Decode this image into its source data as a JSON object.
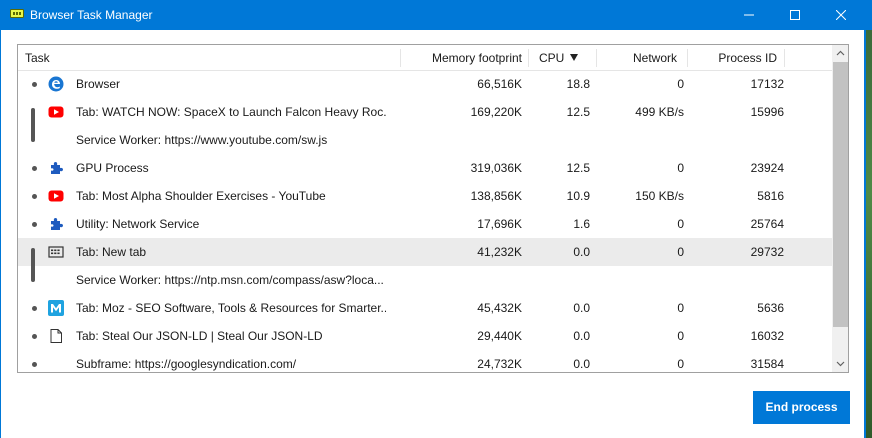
{
  "window": {
    "title": "Browser Task Manager",
    "icons": {
      "app": "browser-task-manager-icon",
      "minimize": "minimize-icon",
      "maximize": "maximize-icon",
      "close": "close-icon"
    }
  },
  "table": {
    "columns": {
      "task": "Task",
      "memory": "Memory footprint",
      "cpu": "CPU",
      "network": "Network",
      "pid": "Process ID"
    },
    "sorted_column": "CPU",
    "sort_direction": "descending",
    "rows": [
      {
        "icon": "edge-icon",
        "task": "Browser",
        "memory": "66,516K",
        "cpu": "18.8",
        "network": "0",
        "pid": "17132"
      },
      {
        "icon": "youtube-icon",
        "task": "Tab: WATCH NOW: SpaceX to Launch Falcon Heavy Roc...",
        "memory": "169,220K",
        "cpu": "12.5",
        "network": "499 KB/s",
        "pid": "15996"
      },
      {
        "icon": "",
        "task": "Service Worker: https://www.youtube.com/sw.js",
        "memory": "",
        "cpu": "",
        "network": "",
        "pid": ""
      },
      {
        "icon": "puzzle-icon",
        "task": "GPU Process",
        "memory": "319,036K",
        "cpu": "12.5",
        "network": "0",
        "pid": "23924"
      },
      {
        "icon": "youtube-icon",
        "task": "Tab: Most Alpha Shoulder Exercises - YouTube",
        "memory": "138,856K",
        "cpu": "10.9",
        "network": "150 KB/s",
        "pid": "5816"
      },
      {
        "icon": "puzzle-icon",
        "task": "Utility: Network Service",
        "memory": "17,696K",
        "cpu": "1.6",
        "network": "0",
        "pid": "25764"
      },
      {
        "icon": "new-tab-icon",
        "task": "Tab: New tab",
        "memory": "41,232K",
        "cpu": "0.0",
        "network": "0",
        "pid": "29732"
      },
      {
        "icon": "",
        "task": "Service Worker: https://ntp.msn.com/compass/asw?loca...",
        "memory": "",
        "cpu": "",
        "network": "",
        "pid": ""
      },
      {
        "icon": "moz-icon",
        "task": "Tab: Moz - SEO Software, Tools & Resources for Smarter...",
        "memory": "45,432K",
        "cpu": "0.0",
        "network": "0",
        "pid": "5636"
      },
      {
        "icon": "page-icon",
        "task": "Tab: Steal Our JSON-LD | Steal Our JSON-LD",
        "memory": "29,440K",
        "cpu": "0.0",
        "network": "0",
        "pid": "16032"
      },
      {
        "icon": "",
        "task": "Subframe: https://googlesyndication.com/",
        "memory": "24,732K",
        "cpu": "0.0",
        "network": "0",
        "pid": "31584"
      }
    ]
  },
  "actions": {
    "end_process": "End process"
  },
  "colors": {
    "accent": "#0078d7",
    "youtube": "#ff0000",
    "selected_row": "#ebebeb"
  }
}
